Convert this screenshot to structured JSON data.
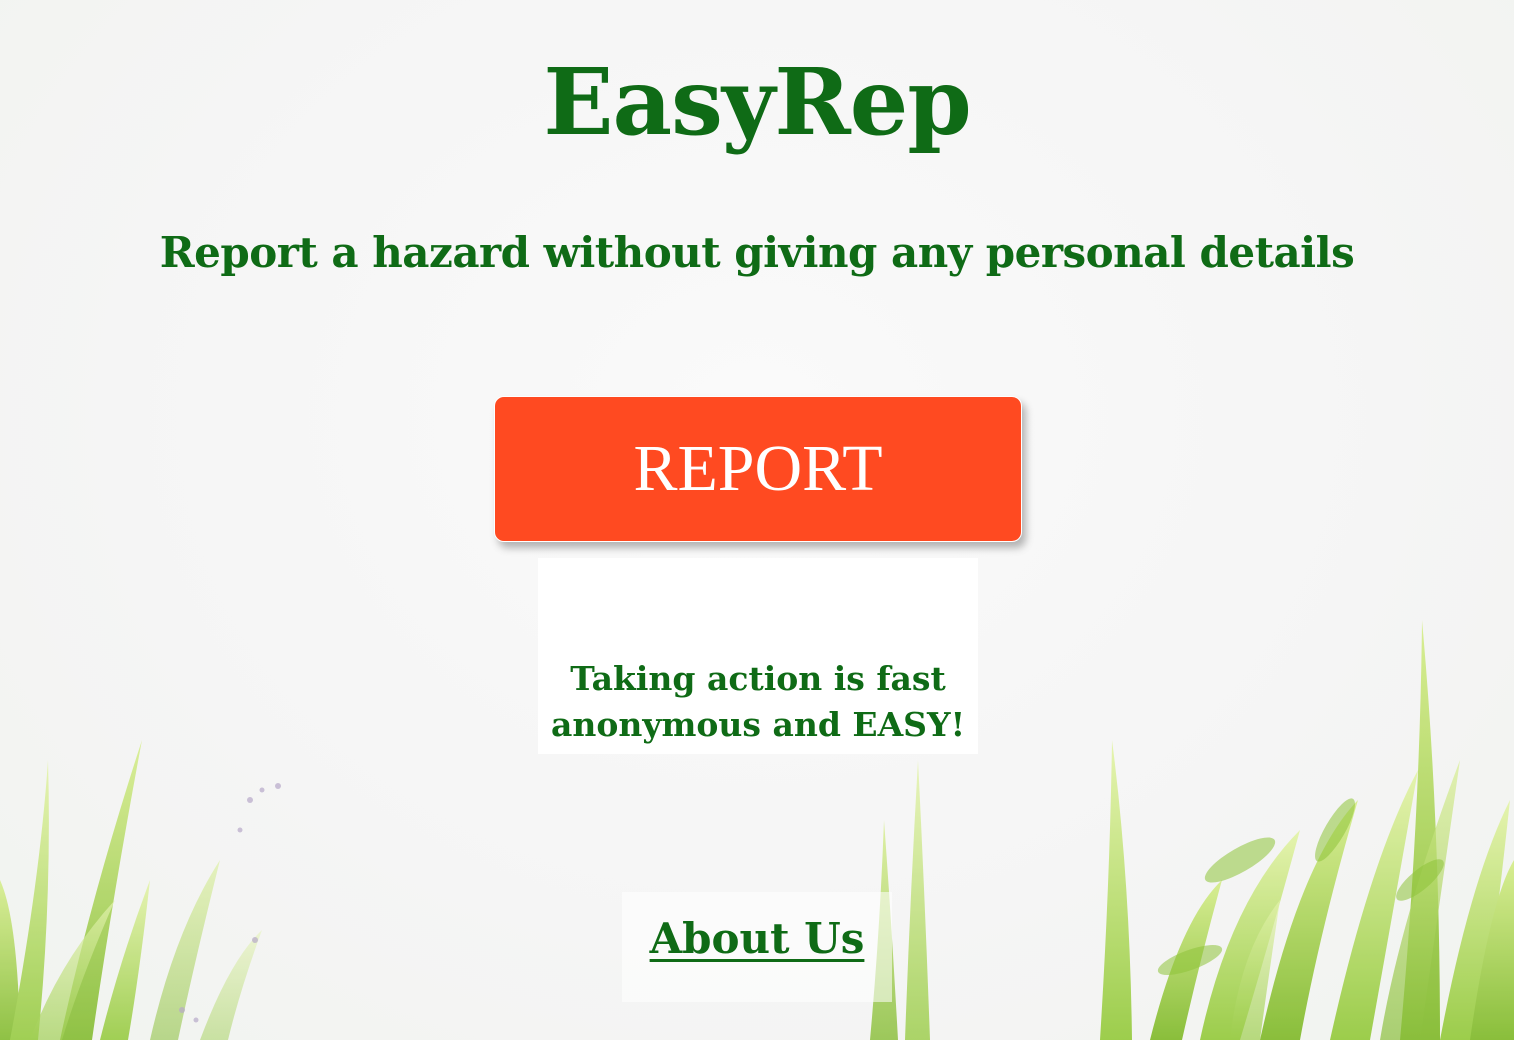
{
  "app": {
    "title": "EasyRep",
    "tagline": "Report a hazard without giving any personal details"
  },
  "report_button": {
    "label": "REPORT"
  },
  "info": {
    "line1": "Taking action is fast",
    "line2": "anonymous and EASY!"
  },
  "footer": {
    "about_label": "About Us"
  },
  "colors": {
    "brand_green": "#0f6b16",
    "button_orange": "#ff4a21",
    "button_text": "#ffffff",
    "grass_green": "#9ccc3a"
  }
}
